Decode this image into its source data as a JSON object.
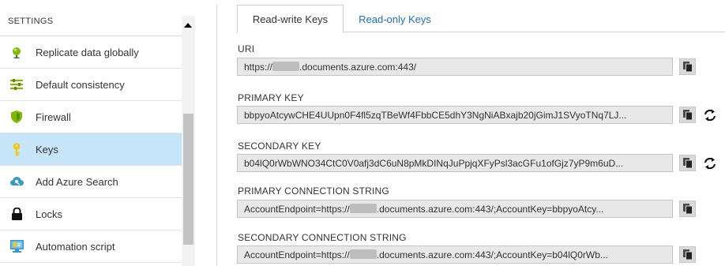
{
  "settings": {
    "header": "SETTINGS",
    "items": [
      {
        "label": "Replicate data globally",
        "icon": "globe-icon"
      },
      {
        "label": "Default consistency",
        "icon": "consistency-bars-icon"
      },
      {
        "label": "Firewall",
        "icon": "shield-icon"
      },
      {
        "label": "Keys",
        "icon": "key-icon",
        "active": true
      },
      {
        "label": "Add Azure Search",
        "icon": "cloud-search-icon"
      },
      {
        "label": "Locks",
        "icon": "lock-icon"
      },
      {
        "label": "Automation script",
        "icon": "automation-script-icon"
      }
    ]
  },
  "tabs": {
    "read_write": "Read-write Keys",
    "read_only": "Read-only Keys",
    "active": "read_write"
  },
  "fields": {
    "uri": {
      "label": "URI",
      "value_prefix": "https://",
      "value_suffix": ".documents.azure.com:443/"
    },
    "primary_key": {
      "label": "PRIMARY KEY",
      "value": "bbpyoAtcywCHE4UUpn0F4fl5zqTBeWf4FbbCE5dhY3NgNiABxajb20jGimJ1SVyoTNq7LJ..."
    },
    "secondary_key": {
      "label": "SECONDARY KEY",
      "value": "b04lQ0rWbWNO34CtC0V0afj3dC6uN8pMkDINqJuPpjqXFyPsl3acGFu1ofGjz7yP9m6uD..."
    },
    "primary_connection_string": {
      "label": "PRIMARY CONNECTION STRING",
      "value_prefix": "AccountEndpoint=https://",
      "value_suffix": ".documents.azure.com:443/;AccountKey=bbpyoAtcy..."
    },
    "secondary_connection_string": {
      "label": "SECONDARY CONNECTION STRING",
      "value_prefix": "AccountEndpoint=https://",
      "value_suffix": ".documents.azure.com:443/;AccountKey=b04lQ0rWb..."
    }
  },
  "icons": {
    "copy": "copy-icon",
    "regenerate": "refresh-icon"
  },
  "colors": {
    "active_item_bg": "#c7e5f8",
    "link_blue": "#1e6fbf",
    "field_bg": "#e8e8e8"
  }
}
